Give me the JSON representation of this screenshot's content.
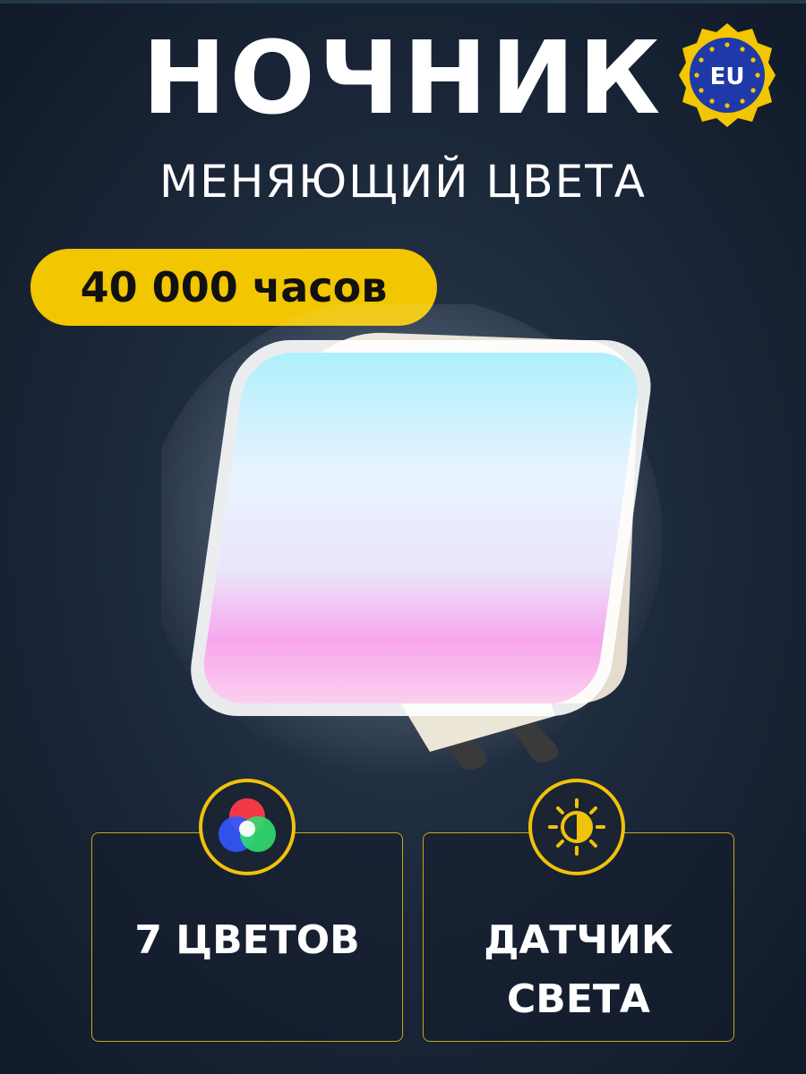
{
  "header": {
    "title": "НОЧНИК",
    "subtitle": "МЕНЯЮЩИЙ ЦВЕТА",
    "badge_text": "EU"
  },
  "hours_badge": {
    "label": "40 000 часов"
  },
  "features": [
    {
      "icon": "rgb-circles-icon",
      "lines": [
        "7 ЦВЕТОВ"
      ]
    },
    {
      "icon": "sun-sensor-icon",
      "lines": [
        "ДАТЧИК",
        "СВЕТА"
      ]
    }
  ],
  "colors": {
    "accent_yellow": "#f2c600",
    "background": "#1d2a3c",
    "text": "#ffffff",
    "eu_blue": "#1f3aa8"
  }
}
